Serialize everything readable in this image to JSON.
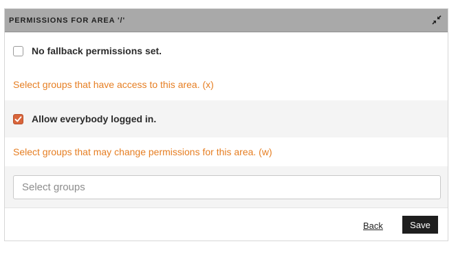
{
  "panel": {
    "title": "PERMISSIONS FOR AREA '/'",
    "collapse_icon": "collapse-arrows-icon"
  },
  "fallback": {
    "checked": false,
    "label": "No fallback permissions set."
  },
  "access_hint": "Select groups that have access to this area. (x)",
  "everybody": {
    "checked": true,
    "label": "Allow everybody logged in."
  },
  "change_hint": "Select groups that may change permissions for this area. (w)",
  "groups_select": {
    "placeholder": "Select groups",
    "value": ""
  },
  "footer": {
    "back_label": "Back",
    "save_label": "Save"
  },
  "colors": {
    "header_bg": "#a9a9a9",
    "accent": "#e67e22",
    "checkbox_checked": "#d9653b",
    "save_bg": "#1e1e1e"
  }
}
